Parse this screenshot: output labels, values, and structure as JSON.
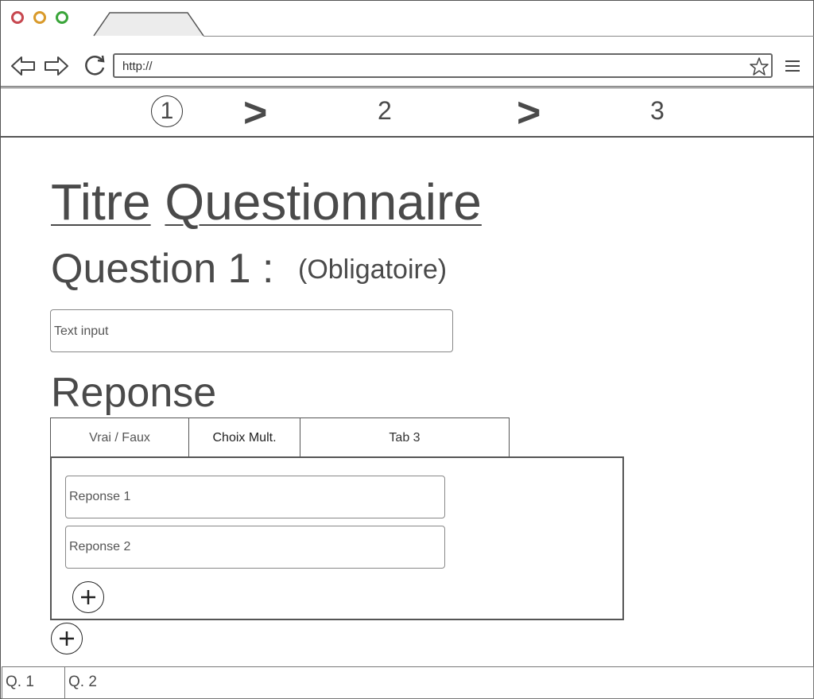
{
  "browser": {
    "url": "http://",
    "colors": {
      "close": "#c7474f",
      "minimize": "#d99a2b",
      "maximize": "#3aa53a"
    }
  },
  "stepper": {
    "steps": [
      "1",
      "2",
      "3"
    ],
    "separator": ">"
  },
  "main": {
    "title_word1": "Titre",
    "title_word2": "Questionnaire",
    "question_label": "Question 1 :",
    "required_label": "(Obligatoire)",
    "question_input_placeholder": "Text input",
    "response_heading": "Reponse"
  },
  "response_tabs": [
    {
      "label": "Vrai / Faux"
    },
    {
      "label": "Choix Mult."
    },
    {
      "label": "Tab 3"
    }
  ],
  "responses": [
    {
      "placeholder": "Reponse 1"
    },
    {
      "placeholder": "Reponse 2"
    }
  ],
  "icons": {
    "back": "arrow-left-icon",
    "forward": "arrow-right-icon",
    "reload": "reload-icon",
    "bookmark": "star-icon",
    "menu": "hamburger-menu-icon",
    "add": "plus-icon"
  },
  "question_tabs": [
    {
      "label": "Q. 1"
    },
    {
      "label": "Q. 2"
    }
  ]
}
